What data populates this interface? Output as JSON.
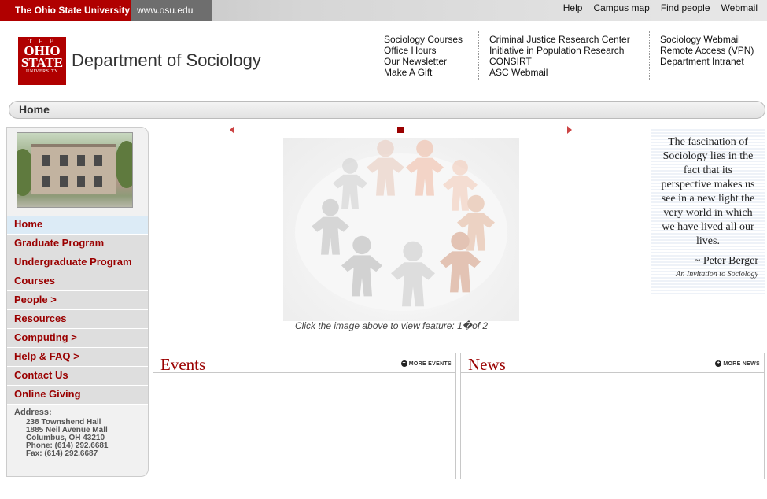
{
  "osu_bar": {
    "university": "The Ohio State University",
    "url": "www.osu.edu",
    "links": [
      "Help",
      "Campus map",
      "Find people",
      "Webmail"
    ]
  },
  "header": {
    "logo_lines": [
      "T H E",
      "OHIO",
      "STATE",
      "UNIVERSITY"
    ],
    "title": "Department of Sociology",
    "col1": [
      "Sociology Courses",
      "Office Hours",
      "Our Newsletter",
      "Make A Gift"
    ],
    "col2": [
      "Criminal Justice Research Center",
      "Initiative in Population Research",
      "CONSIRT",
      "ASC Webmail"
    ],
    "col3": [
      "Sociology Webmail",
      "Remote Access (VPN)",
      "Department Intranet"
    ]
  },
  "breadcrumb": "Home",
  "sidebar": {
    "nav": [
      {
        "label": "Home",
        "active": true
      },
      {
        "label": "Graduate Program"
      },
      {
        "label": "Undergraduate Program"
      },
      {
        "label": "Courses"
      },
      {
        "label": "People >"
      },
      {
        "label": "Resources"
      },
      {
        "label": "Computing >"
      },
      {
        "label": "Help & FAQ >"
      },
      {
        "label": "Contact Us"
      },
      {
        "label": "Online Giving"
      }
    ],
    "address_label": "Address:",
    "address_lines": [
      "238 Townshend Hall",
      "1885 Neil Avenue Mall",
      "Columbus, OH 43210",
      "Phone: (614) 292.6681",
      "Fax: (614) 292.6687"
    ]
  },
  "feature": {
    "caption": "Click the image above to view feature: 1�of 2"
  },
  "quote": {
    "text": "The fascination of Sociology lies in the fact that its perspective makes us see in a new light the very world in which we have lived all our lives.",
    "author": "~ Peter Berger",
    "source": "An Invitation to Sociology"
  },
  "events": {
    "title": "Events",
    "more": "MORE EVENTS"
  },
  "news": {
    "title": "News",
    "more": "MORE NEWS"
  },
  "colors": {
    "osu_red": "#b00000",
    "nav_red": "#9a0000",
    "active_nav": "#dcebf6"
  }
}
